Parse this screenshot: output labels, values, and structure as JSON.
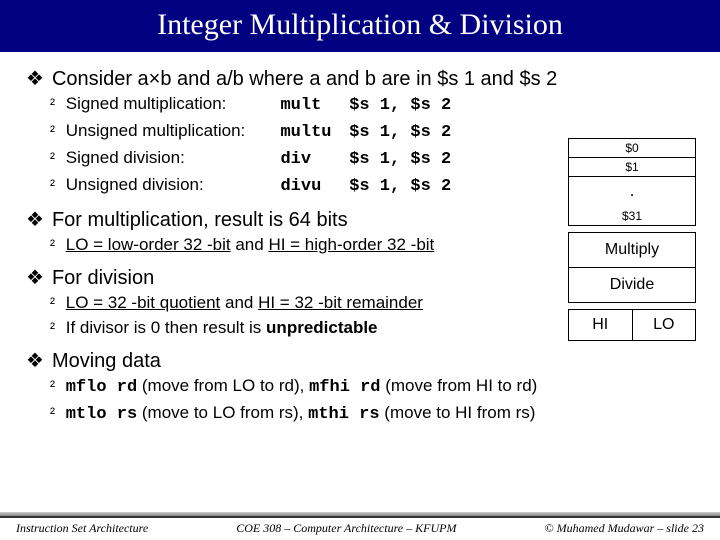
{
  "title": "Integer Multiplication & Division",
  "b1": "Consider a×b and a/b where a and b are in $s 1 and $s 2",
  "ops": [
    {
      "lbl": "Signed multiplication:",
      "mne": "mult",
      "arg": "$s 1, $s 2"
    },
    {
      "lbl": "Unsigned multiplication:",
      "mne": "multu",
      "arg": "$s 1, $s 2"
    },
    {
      "lbl": "Signed division:",
      "mne": "div",
      "arg": "$s 1, $s 2"
    },
    {
      "lbl": "Unsigned division:",
      "mne": "divu",
      "arg": "$s 1, $s 2"
    }
  ],
  "b2": "For multiplication, result is 64 bits",
  "b2s1a": "LO = low-order 32 -bit",
  "b2s1b": " and ",
  "b2s1c": "HI = high-order 32 -bit",
  "b3": "For division",
  "b3s1a": "LO = 32 -bit quotient",
  "b3s1b": " and ",
  "b3s1c": "HI = 32 -bit remainder",
  "b3s2a": "If divisor is 0 then result is ",
  "b3s2b": "unpredictable",
  "b4": "Moving data",
  "b4s1_m1": "mflo rd",
  "b4s1_t1": " (move from LO to rd), ",
  "b4s1_m2": "mfhi rd",
  "b4s1_t2": " (move from HI to rd)",
  "b4s2_m1": "mtlo rs",
  "b4s2_t1": " (move to LO from rs), ",
  "b4s2_m2": "mthi rs",
  "b4s2_t2": " (move to HI from rs)",
  "diagram": {
    "r0": "$0",
    "r1": "$1",
    "dots": ".",
    "r31": "$31",
    "mul": "Multiply",
    "div": "Divide",
    "hi": "HI",
    "lo": "LO"
  },
  "footer": {
    "left": "Instruction Set Architecture",
    "mid": "COE 308 – Computer Architecture – KFUPM",
    "right": "© Muhamed Mudawar – slide 23"
  }
}
